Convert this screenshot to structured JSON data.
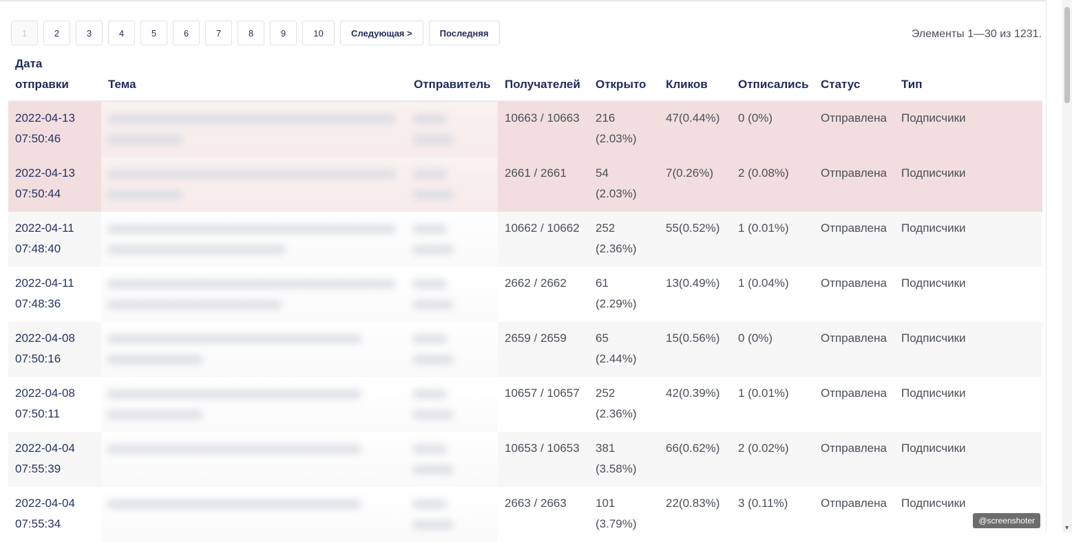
{
  "pagination": {
    "pages": [
      "1",
      "2",
      "3",
      "4",
      "5",
      "6",
      "7",
      "8",
      "9",
      "10"
    ],
    "current": "1",
    "next_label": "Следующая >",
    "last_label": "Последняя"
  },
  "counter_text": "Элементы 1—30 из 1231.",
  "table": {
    "headers": {
      "date_line1": "Дата",
      "date_line2": "отправки",
      "subject": "Тема",
      "sender": "Отправитель",
      "recipients": "Получателей",
      "opened": "Открыто",
      "clicks": "Кликов",
      "unsubscribed": "Отписались",
      "status": "Статус",
      "type": "Тип"
    },
    "rows": [
      {
        "date": "2022-04-13",
        "time": "07:50:46",
        "recipients": "10663 / 10663",
        "opened_a": "216",
        "opened_b": "(2.03%)",
        "clicks": "47(0.44%)",
        "unsub": "0 (0%)",
        "status": "Отправлена",
        "type": "Подписчики"
      },
      {
        "date": "2022-04-13",
        "time": "07:50:44",
        "recipients": "2661 / 2661",
        "opened_a": "54 (2.03%)",
        "opened_b": "",
        "clicks": "7(0.26%)",
        "unsub": "2 (0.08%)",
        "status": "Отправлена",
        "type": "Подписчики"
      },
      {
        "date": "2022-04-11",
        "time": "07:48:40",
        "recipients": "10662 / 10662",
        "opened_a": "252",
        "opened_b": "(2.36%)",
        "clicks": "55(0.52%)",
        "unsub": "1 (0.01%)",
        "status": "Отправлена",
        "type": "Подписчики"
      },
      {
        "date": "2022-04-11",
        "time": "07:48:36",
        "recipients": "2662 / 2662",
        "opened_a": "61 (2.29%)",
        "opened_b": "",
        "clicks": "13(0.49%)",
        "unsub": "1 (0.04%)",
        "status": "Отправлена",
        "type": "Подписчики"
      },
      {
        "date": "2022-04-08",
        "time": "07:50:16",
        "recipients": "2659 / 2659",
        "opened_a": "65 (2.44%)",
        "opened_b": "",
        "clicks": "15(0.56%)",
        "unsub": "0 (0%)",
        "status": "Отправлена",
        "type": "Подписчики"
      },
      {
        "date": "2022-04-08",
        "time": "07:50:11",
        "recipients": "10657 / 10657",
        "opened_a": "252",
        "opened_b": "(2.36%)",
        "clicks": "42(0.39%)",
        "unsub": "1 (0.01%)",
        "status": "Отправлена",
        "type": "Подписчики"
      },
      {
        "date": "2022-04-04",
        "time": "07:55:39",
        "recipients": "10653 / 10653",
        "opened_a": "381",
        "opened_b": "(3.58%)",
        "clicks": "66(0.62%)",
        "unsub": "2 (0.02%)",
        "status": "Отправлена",
        "type": "Подписчики"
      },
      {
        "date": "2022-04-04",
        "time": "07:55:34",
        "recipients": "2663 / 2663",
        "opened_a": "101",
        "opened_b": "(3.79%)",
        "clicks": "22(0.83%)",
        "unsub": "3 (0.11%)",
        "status": "Отправлена",
        "type": "Подписчики"
      }
    ]
  },
  "watermark": "@screenshoter",
  "colors": {
    "header_text": "#1f2a5a",
    "highlight_row": "#f2dede",
    "striped_row": "#f7f7f7"
  }
}
